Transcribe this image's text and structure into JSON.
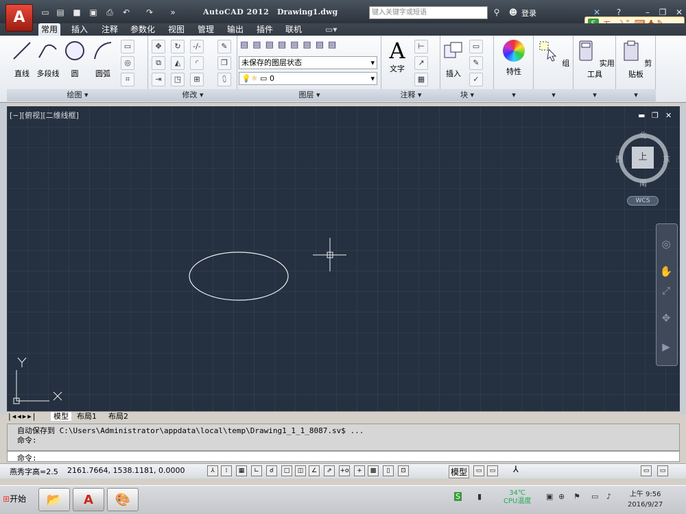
{
  "title_bar": {
    "app_name": "AutoCAD 2012",
    "drawing_name": "Drawing1.dwg",
    "search_placeholder": "键入关键字或短语",
    "login_label": "登录",
    "app_button_letter": "A"
  },
  "tabs": [
    "常用",
    "插入",
    "注释",
    "参数化",
    "视图",
    "管理",
    "输出",
    "插件",
    "联机"
  ],
  "ribbon": {
    "draw": {
      "title": "绘图",
      "buttons": [
        "直线",
        "多段线",
        "圆",
        "圆弧"
      ]
    },
    "modify": {
      "title": "修改"
    },
    "layers": {
      "title": "图层",
      "layer_state": "未保存的图层状态",
      "current_layer": "0"
    },
    "annotation": {
      "title": "注释",
      "text_label": "文字"
    },
    "block": {
      "title": "块",
      "insert_label": "插入"
    },
    "properties_label": "特性",
    "group_label": "组",
    "utilities_label": "实用工具",
    "clipboard_label": "剪贴板"
  },
  "viewport": {
    "label": "[−][俯视][二维线框]",
    "compass": {
      "north": "北",
      "south": "南",
      "east": "东",
      "west": "西",
      "top": "上"
    },
    "wcs": "WCS",
    "ucs_x": "X",
    "ucs_y": "Y"
  },
  "layout_tabs": [
    "模型",
    "布局1",
    "布局2"
  ],
  "command": {
    "history_line1": "自动保存到 C:\\Users\\Administrator\\appdata\\local\\temp\\Drawing1_1_1_8087.sv$ ...",
    "history_line2": "命令:",
    "prompt": "命令:"
  },
  "status": {
    "text_height": "燕秀字高=2.5",
    "coordinates": "2161.7664, 1538.1181, 0.0000",
    "model_label": "模型"
  },
  "taskbar": {
    "start_label": "开始",
    "clock_time": "9:56",
    "clock_date": "2016/9/27",
    "cpu_temp": "34℃",
    "cpu_label": "CPU温度",
    "ampm": "上午"
  },
  "ime": {
    "label": "五"
  },
  "colors": {
    "canvas": "#253040",
    "ellipse": "#f0f0f0",
    "titlebar": "#2c333b",
    "appbutton": "#c8281a"
  }
}
